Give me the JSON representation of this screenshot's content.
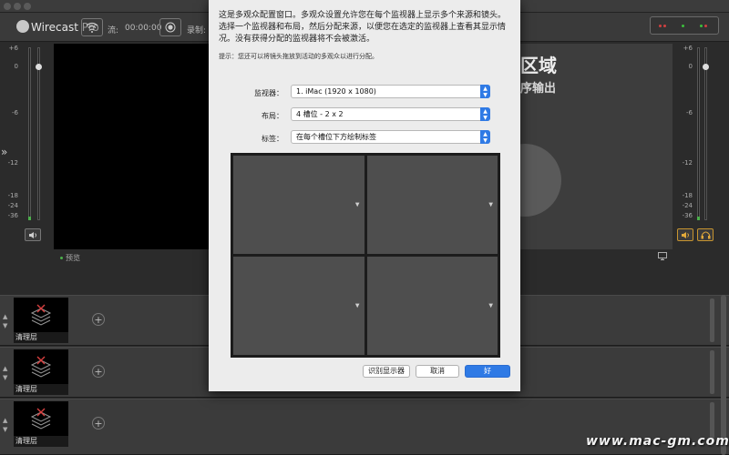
{
  "app": {
    "brand": "Wirecast",
    "brand_suffix": "Pro",
    "stream_label": "流:",
    "stream_time": "00:00:00",
    "record_label": "录制:"
  },
  "meters": {
    "left_scale": [
      "+6",
      "0",
      "-6",
      "-12",
      "-18",
      "-24",
      "-36"
    ],
    "right_scale": [
      "+6",
      "0",
      "-6",
      "-12",
      "-18",
      "-24",
      "-36"
    ]
  },
  "preview": {
    "label": "预览"
  },
  "output": {
    "title_partial": "区域",
    "subtitle_partial": "程序输出"
  },
  "layers": [
    {
      "thumb_label": "清理层"
    },
    {
      "thumb_label": "清理层"
    },
    {
      "thumb_label": "清理层"
    }
  ],
  "dialog": {
    "intro": "这是多观众配置窗口。多观众设置允许您在每个监视器上显示多个来源和镜头。选择一个监视器和布局，然后分配来源，以便您在选定的监视器上查看其显示情况。没有获得分配的监视器将不会被激活。",
    "hint": "提示：您还可以将镜头拖放到活动的多观众以进行分配。",
    "monitor_label": "监视器：",
    "monitor_value": "1. iMac (1920 x 1080)",
    "layout_label": "布局：",
    "layout_value": "4 槽位 - 2 x 2",
    "tags_label": "标签：",
    "tags_value": "在每个槽位下方绘制标签",
    "identify_button": "识别显示器",
    "cancel_button": "取消",
    "ok_button": "好"
  },
  "watermark": "www.mac-gm.com",
  "colors": {
    "accent_blue": "#2f7ae5",
    "led_red": "#d04040",
    "led_green": "#3cbf3c",
    "meter_level_green": "#4bb04b"
  }
}
